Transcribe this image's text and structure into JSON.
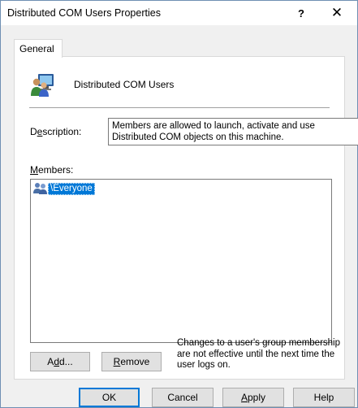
{
  "window": {
    "title": "Distributed COM Users Properties",
    "help_glyph": "?",
    "close_glyph": "✕"
  },
  "tabs": [
    {
      "label": "General"
    }
  ],
  "group": {
    "name": "Distributed COM Users",
    "icon": "users-monitor-icon"
  },
  "description": {
    "label_pre": "D",
    "label_u": "e",
    "label_post": "scription:",
    "text_line1": "Members are allowed to launch, activate and use",
    "text_line2": "Distributed COM objects on this machine."
  },
  "members": {
    "label_u": "M",
    "label_post": "embers:",
    "items": [
      {
        "name": "\\Everyone",
        "icon": "users-icon"
      }
    ]
  },
  "buttons": {
    "add_u": "d",
    "add_pre": "A",
    "add_post": "d...",
    "remove_u": "R",
    "remove_post": "emove",
    "ok": "OK",
    "cancel": "Cancel",
    "apply_u": "A",
    "apply_post": "pply",
    "help": "Help"
  },
  "note": {
    "line1": "Changes to a user's group membership",
    "line2": "are not effective until the next time the",
    "line3": "user logs on."
  },
  "colors": {
    "selection": "#0078d7",
    "window_border": "#6f8fb3",
    "dialog_bg": "#f0f0f0"
  }
}
